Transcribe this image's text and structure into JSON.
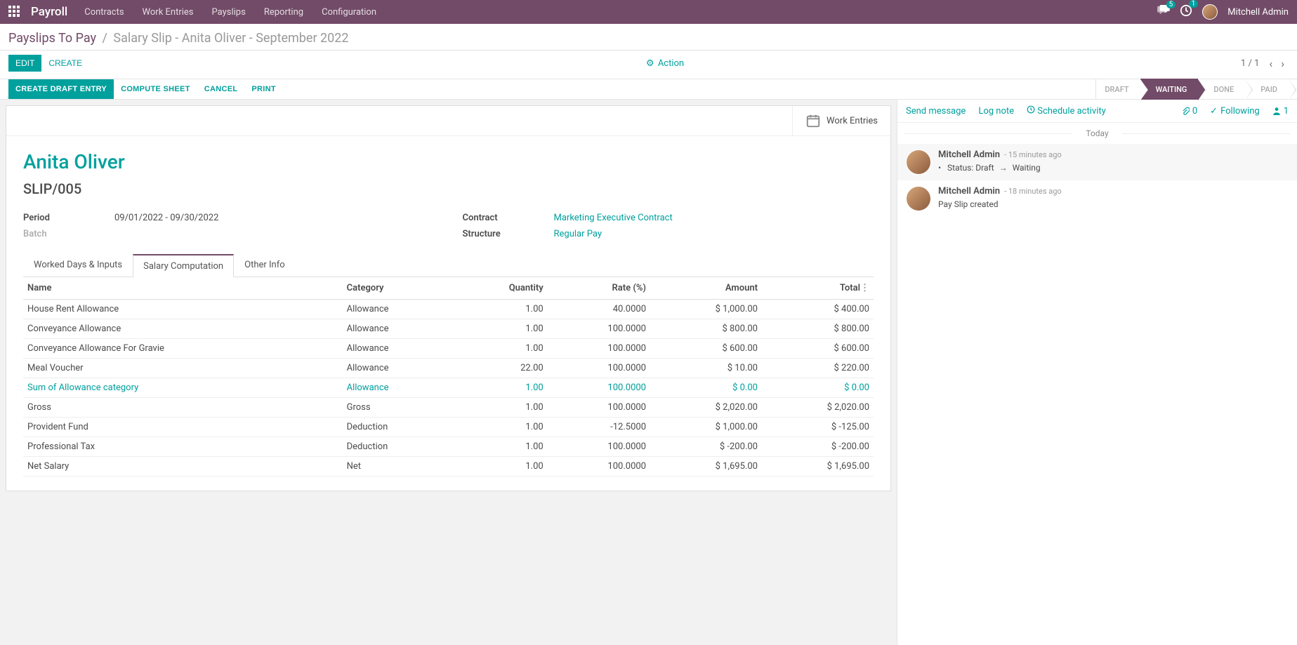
{
  "topnav": {
    "brand": "Payroll",
    "menu": [
      "Contracts",
      "Work Entries",
      "Payslips",
      "Reporting",
      "Configuration"
    ],
    "messages_badge": "5",
    "activities_badge": "1",
    "username": "Mitchell Admin"
  },
  "breadcrumb": {
    "link": "Payslips To Pay",
    "sep": "/",
    "current": "Salary Slip - Anita Oliver - September 2022"
  },
  "controlbar": {
    "edit": "EDIT",
    "create": "CREATE",
    "action": "Action",
    "pager_current": "1",
    "pager_sep": "/",
    "pager_total": "1"
  },
  "statusbar": {
    "buttons": {
      "create_draft": "CREATE DRAFT ENTRY",
      "compute": "COMPUTE SHEET",
      "cancel": "CANCEL",
      "print": "PRINT"
    },
    "steps": [
      "DRAFT",
      "WAITING",
      "DONE",
      "PAID"
    ],
    "active_index": 1
  },
  "sheet": {
    "smartbutton": "Work Entries",
    "title": "Anita Oliver",
    "reference": "SLIP/005",
    "fields": {
      "period_label": "Period",
      "period_value": "09/01/2022 - 09/30/2022",
      "batch_label": "Batch",
      "batch_value": "",
      "contract_label": "Contract",
      "contract_value": "Marketing Executive Contract",
      "structure_label": "Structure",
      "structure_value": "Regular Pay"
    },
    "tabs": [
      "Worked Days & Inputs",
      "Salary Computation",
      "Other Info"
    ],
    "active_tab": 1,
    "table": {
      "headers": [
        "Name",
        "Category",
        "Quantity",
        "Rate (%)",
        "Amount",
        "Total"
      ],
      "rows": [
        {
          "name": "House Rent Allowance",
          "category": "Allowance",
          "qty": "1.00",
          "rate": "40.0000",
          "amount": "$ 1,000.00",
          "total": "$ 400.00"
        },
        {
          "name": "Conveyance Allowance",
          "category": "Allowance",
          "qty": "1.00",
          "rate": "100.0000",
          "amount": "$ 800.00",
          "total": "$ 800.00"
        },
        {
          "name": "Conveyance Allowance For Gravie",
          "category": "Allowance",
          "qty": "1.00",
          "rate": "100.0000",
          "amount": "$ 600.00",
          "total": "$ 600.00"
        },
        {
          "name": "Meal Voucher",
          "category": "Allowance",
          "qty": "22.00",
          "rate": "100.0000",
          "amount": "$ 10.00",
          "total": "$ 220.00"
        },
        {
          "name": "Sum of Allowance category",
          "category": "Allowance",
          "qty": "1.00",
          "rate": "100.0000",
          "amount": "$ 0.00",
          "total": "$ 0.00",
          "hl": true
        },
        {
          "name": "Gross",
          "category": "Gross",
          "qty": "1.00",
          "rate": "100.0000",
          "amount": "$ 2,020.00",
          "total": "$ 2,020.00"
        },
        {
          "name": "Provident Fund",
          "category": "Deduction",
          "qty": "1.00",
          "rate": "-12.5000",
          "amount": "$ 1,000.00",
          "total": "$ -125.00"
        },
        {
          "name": "Professional Tax",
          "category": "Deduction",
          "qty": "1.00",
          "rate": "100.0000",
          "amount": "$ -200.00",
          "total": "$ -200.00"
        },
        {
          "name": "Net Salary",
          "category": "Net",
          "qty": "1.00",
          "rate": "100.0000",
          "amount": "$ 1,695.00",
          "total": "$ 1,695.00"
        }
      ]
    }
  },
  "chatter": {
    "send_message": "Send message",
    "log_note": "Log note",
    "schedule": "Schedule activity",
    "attachments": "0",
    "following": "Following",
    "followers": "1",
    "today": "Today",
    "messages": [
      {
        "author": "Mitchell Admin",
        "time": "- 15 minutes ago",
        "status_prefix": "Status:",
        "status_from": "Draft",
        "status_to": "Waiting"
      },
      {
        "author": "Mitchell Admin",
        "time": "- 18 minutes ago",
        "body": "Pay Slip created"
      }
    ]
  }
}
